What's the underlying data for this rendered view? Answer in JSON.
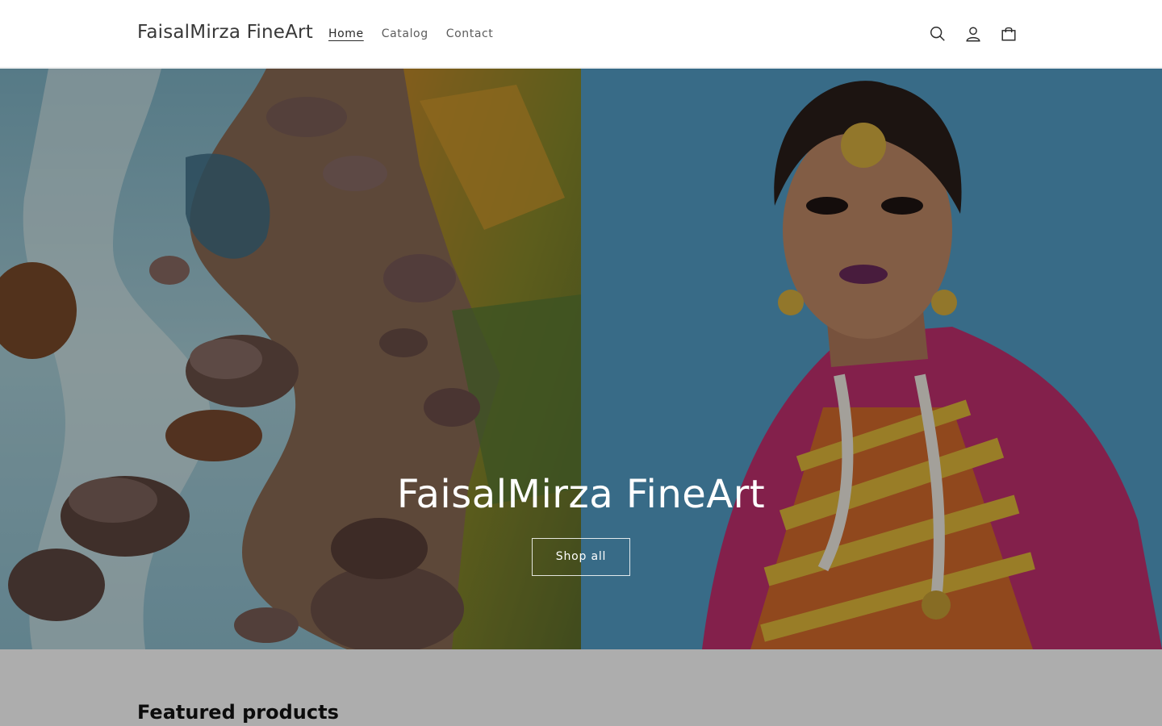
{
  "header": {
    "logo": "FaisalMirza FineArt",
    "nav": [
      {
        "label": "Home",
        "active": true
      },
      {
        "label": "Catalog",
        "active": false
      },
      {
        "label": "Contact",
        "active": false
      }
    ],
    "icons": [
      "search-icon",
      "account-icon",
      "cart-icon"
    ]
  },
  "hero": {
    "title": "FaisalMirza FineArt",
    "button": "Shop all",
    "left_image": "river-rocks-painting",
    "right_image": "woman-portrait-painting"
  },
  "featured": {
    "title": "Featured products"
  }
}
